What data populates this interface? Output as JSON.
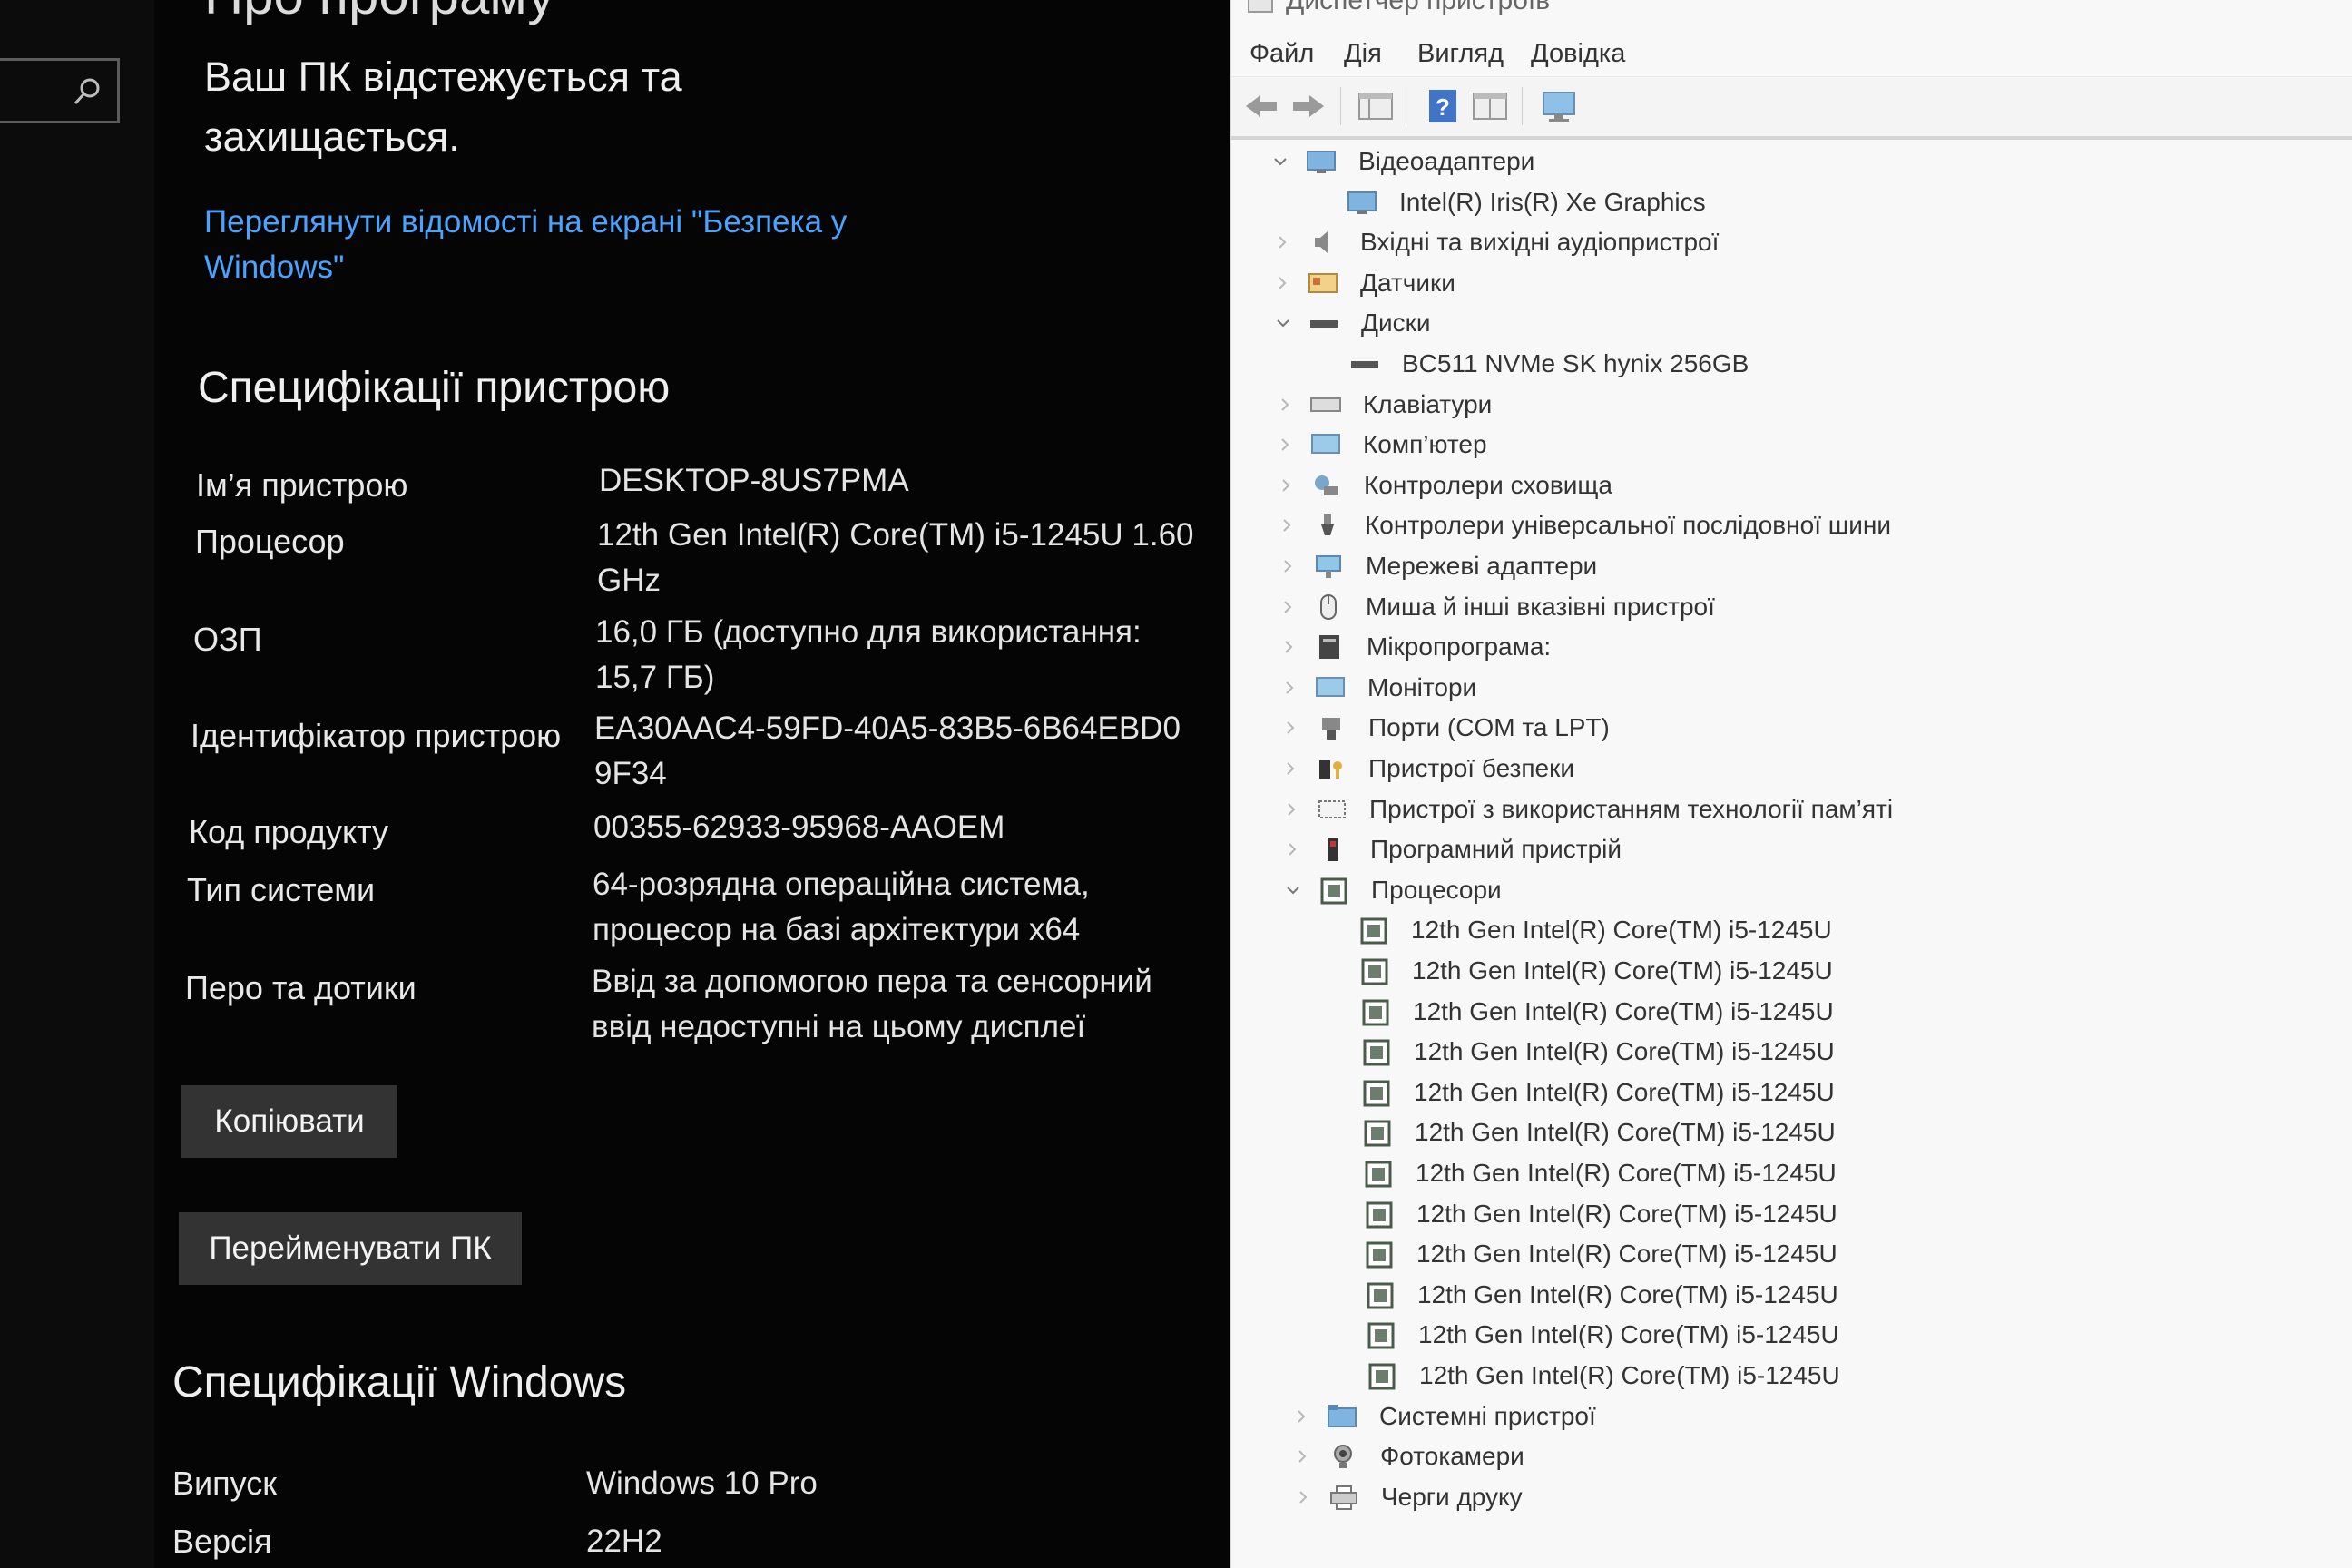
{
  "settings": {
    "page_title": "Про програму",
    "protection_message": "Ваш ПК відстежується та захищається.",
    "security_link": "Переглянути відомості на екрані \"Безпека у Windows\"",
    "device_specs": {
      "title": "Специфікації пристрою",
      "rows": [
        {
          "label": "Ім’я пристрою",
          "value": "DESKTOP-8US7PMA"
        },
        {
          "label": "Процесор",
          "value": "12th Gen Intel(R) Core(TM) i5-1245U   1.60 GHz"
        },
        {
          "label": "ОЗП",
          "value": "16,0 ГБ (доступно для використання: 15,7 ГБ)"
        },
        {
          "label": "Ідентифікатор пристрою",
          "value": "EA30AAC4-59FD-40A5-83B5-6B64EBD09F34"
        },
        {
          "label": "Код продукту",
          "value": "00355-62933-95968-AAOEM"
        },
        {
          "label": "Тип системи",
          "value": "64-розрядна операційна система, процесор на базі архітектури x64"
        },
        {
          "label": "Перо та дотики",
          "value": "Ввід за допомогою пера та сенсорний ввід недоступні на цьому дисплеї"
        }
      ],
      "copy_button": "Копіювати",
      "rename_button": "Перейменувати ПК"
    },
    "windows_specs": {
      "title": "Специфікації Windows",
      "rows": [
        {
          "label": "Випуск",
          "value": "Windows 10 Pro"
        },
        {
          "label": "Версія",
          "value": "22H2"
        }
      ]
    }
  },
  "device_manager": {
    "window_title": "Диспетчер пристроїв",
    "menu": [
      "Файл",
      "Дія",
      "Вигляд",
      "Довідка"
    ],
    "toolbar_icons": [
      "back-icon",
      "forward-icon",
      "properties-icon",
      "help-icon",
      "view-icon",
      "monitor-icon"
    ],
    "tree": [
      {
        "label": "Відеоадаптери",
        "level": 0,
        "state": "expanded",
        "icon": "display-adapter-icon"
      },
      {
        "label": "Intel(R) Iris(R) Xe Graphics",
        "level": 1,
        "state": "leaf",
        "icon": "display-adapter-icon"
      },
      {
        "label": "Вхідні та вихідні аудіопристрої",
        "level": 0,
        "state": "collapsed",
        "icon": "speaker-icon"
      },
      {
        "label": "Датчики",
        "level": 0,
        "state": "collapsed",
        "icon": "sensor-icon"
      },
      {
        "label": "Диски",
        "level": 0,
        "state": "expanded",
        "icon": "disk-icon"
      },
      {
        "label": "BC511 NVMe SK hynix 256GB",
        "level": 1,
        "state": "leaf",
        "icon": "disk-icon"
      },
      {
        "label": "Клавіатури",
        "level": 0,
        "state": "collapsed",
        "icon": "keyboard-icon"
      },
      {
        "label": "Комп’ютер",
        "level": 0,
        "state": "collapsed",
        "icon": "computer-icon"
      },
      {
        "label": "Контролери сховища",
        "level": 0,
        "state": "collapsed",
        "icon": "storage-controller-icon"
      },
      {
        "label": "Контролери універсальної послідовної шини",
        "level": 0,
        "state": "collapsed",
        "icon": "usb-icon"
      },
      {
        "label": "Мережеві адаптери",
        "level": 0,
        "state": "collapsed",
        "icon": "network-icon"
      },
      {
        "label": "Миша й інші вказівні пристрої",
        "level": 0,
        "state": "collapsed",
        "icon": "mouse-icon"
      },
      {
        "label": "Мікропрограма:",
        "level": 0,
        "state": "collapsed",
        "icon": "firmware-icon"
      },
      {
        "label": "Монітори",
        "level": 0,
        "state": "collapsed",
        "icon": "monitor-icon"
      },
      {
        "label": "Порти (COM та LPT)",
        "level": 0,
        "state": "collapsed",
        "icon": "port-icon"
      },
      {
        "label": "Пристрої безпеки",
        "level": 0,
        "state": "collapsed",
        "icon": "security-device-icon"
      },
      {
        "label": "Пристрої з використанням технології пам’яті",
        "level": 0,
        "state": "collapsed",
        "icon": "memory-device-icon"
      },
      {
        "label": "Програмний пристрій",
        "level": 0,
        "state": "collapsed",
        "icon": "software-device-icon"
      },
      {
        "label": "Процесори",
        "level": 0,
        "state": "expanded",
        "icon": "processor-icon"
      },
      {
        "label": "12th Gen Intel(R) Core(TM) i5-1245U",
        "level": 1,
        "state": "leaf",
        "icon": "processor-icon"
      },
      {
        "label": "12th Gen Intel(R) Core(TM) i5-1245U",
        "level": 1,
        "state": "leaf",
        "icon": "processor-icon"
      },
      {
        "label": "12th Gen Intel(R) Core(TM) i5-1245U",
        "level": 1,
        "state": "leaf",
        "icon": "processor-icon"
      },
      {
        "label": "12th Gen Intel(R) Core(TM) i5-1245U",
        "level": 1,
        "state": "leaf",
        "icon": "processor-icon"
      },
      {
        "label": "12th Gen Intel(R) Core(TM) i5-1245U",
        "level": 1,
        "state": "leaf",
        "icon": "processor-icon"
      },
      {
        "label": "12th Gen Intel(R) Core(TM) i5-1245U",
        "level": 1,
        "state": "leaf",
        "icon": "processor-icon"
      },
      {
        "label": "12th Gen Intel(R) Core(TM) i5-1245U",
        "level": 1,
        "state": "leaf",
        "icon": "processor-icon"
      },
      {
        "label": "12th Gen Intel(R) Core(TM) i5-1245U",
        "level": 1,
        "state": "leaf",
        "icon": "processor-icon"
      },
      {
        "label": "12th Gen Intel(R) Core(TM) i5-1245U",
        "level": 1,
        "state": "leaf",
        "icon": "processor-icon"
      },
      {
        "label": "12th Gen Intel(R) Core(TM) i5-1245U",
        "level": 1,
        "state": "leaf",
        "icon": "processor-icon"
      },
      {
        "label": "12th Gen Intel(R) Core(TM) i5-1245U",
        "level": 1,
        "state": "leaf",
        "icon": "processor-icon"
      },
      {
        "label": "12th Gen Intel(R) Core(TM) i5-1245U",
        "level": 1,
        "state": "leaf",
        "icon": "processor-icon"
      },
      {
        "label": "Системні пристрої",
        "level": 0,
        "state": "collapsed",
        "icon": "system-devices-icon"
      },
      {
        "label": "Фотокамери",
        "level": 0,
        "state": "collapsed",
        "icon": "camera-icon"
      },
      {
        "label": "Черги друку",
        "level": 0,
        "state": "collapsed",
        "icon": "printer-icon"
      }
    ]
  }
}
